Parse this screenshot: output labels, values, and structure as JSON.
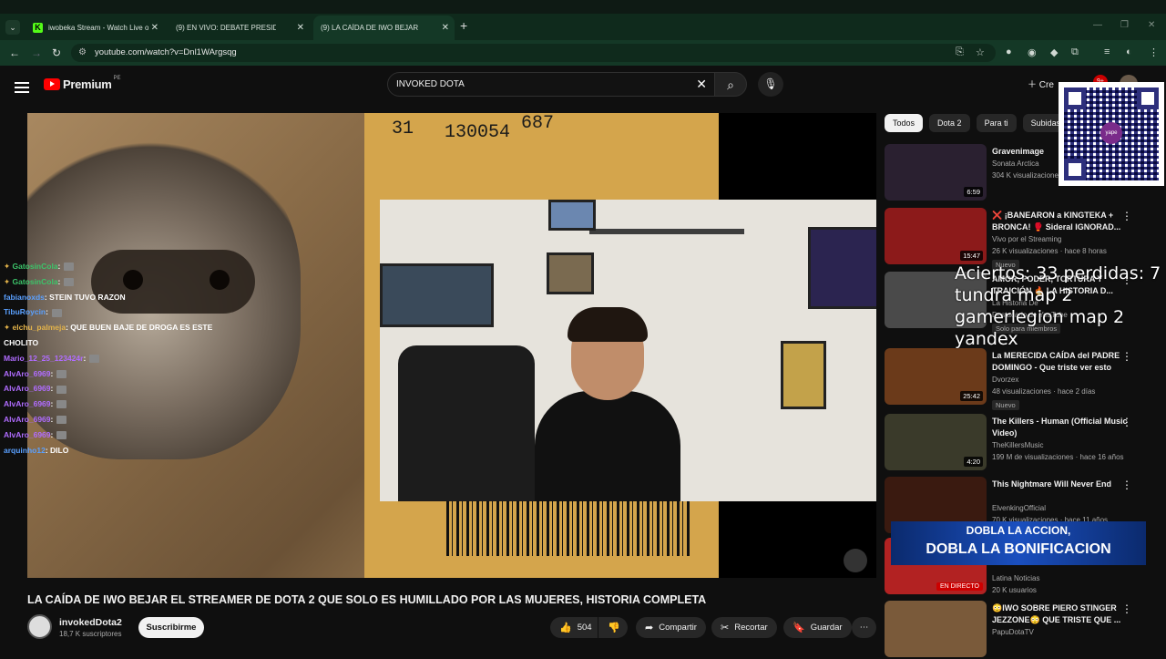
{
  "browser": {
    "tabs": [
      {
        "title": "iwobeka Stream - Watch Live o",
        "favicon": "kick-icon"
      },
      {
        "title": "(9) EN VIVO: DEBATE PRESIDEN",
        "favicon": "youtube-icon"
      },
      {
        "title": "(9) LA CAÍDA DE IWO BEJAR EL",
        "favicon": "youtube-icon",
        "active": true
      }
    ],
    "url": "youtube.com/watch?v=Dnl1WArgsqg"
  },
  "header": {
    "logo_text": "Premium",
    "country_code": "PE",
    "search_value": "INVOKED DOTA",
    "create_label": "Cre",
    "notifications": "9+"
  },
  "chat": [
    {
      "user": "GatosinCola",
      "color": "#3cc46a",
      "msg": ":",
      "emote": true,
      "badge": true
    },
    {
      "user": "GatosinCola",
      "color": "#3cc46a",
      "msg": ":",
      "emote": true,
      "badge": true
    },
    {
      "user": "fabianoxds",
      "color": "#5aa0ff",
      "msg": ": STEIN TUVO RAZON",
      "emote": false
    },
    {
      "user": "TibuRoycin",
      "color": "#5aa0ff",
      "msg": ":",
      "emote": true
    },
    {
      "user": "elchu_palmeja",
      "color": "#e3b34a",
      "msg": ": QUE BUEN BAJE DE DROGA ES ESTE",
      "emote": false,
      "badge": true
    },
    {
      "user": "",
      "color": "#fff",
      "msg": "CHOLITO",
      "emote": false
    },
    {
      "user": "Mario_12_25_123424r",
      "color": "#b06cff",
      "msg": ":",
      "emote": true
    },
    {
      "user": "AlvAro_6969",
      "color": "#b06cff",
      "msg": ":",
      "emote": true
    },
    {
      "user": "AlvAro_6969",
      "color": "#b06cff",
      "msg": ":",
      "emote": true
    },
    {
      "user": "AlvAro_6969",
      "color": "#b06cff",
      "msg": ":",
      "emote": true
    },
    {
      "user": "AlvAro_6969",
      "color": "#b06cff",
      "msg": ":",
      "emote": true
    },
    {
      "user": "AlvAro_6969",
      "color": "#b06cff",
      "msg": ":",
      "emote": true
    },
    {
      "user": "arquinho12",
      "color": "#5aa0ff",
      "msg": ": DILO",
      "emote": false
    }
  ],
  "box_text": {
    "left": "31",
    "mid": "130054",
    "right": "687"
  },
  "video": {
    "title": "LA CAÍDA DE IWO BEJAR EL STREAMER DE DOTA 2 QUE SOLO ES HUMILLADO POR LAS MUJERES, HISTORIA COMPLETA",
    "channel": "invokedDota2",
    "subscribers": "18,7 K suscriptores",
    "subscribe_label": "Suscribirme",
    "likes": "504",
    "share_label": "Compartir",
    "clip_label": "Recortar",
    "save_label": "Guardar"
  },
  "chips": [
    "Todos",
    "Dota 2",
    "Para ti",
    "Subidas r"
  ],
  "recommendations": [
    {
      "title": "Gravenimage",
      "channel": "Sonata Arctica",
      "views": "304 K visualizaciones",
      "duration": "6:59",
      "thumb": "#2a2030"
    },
    {
      "title": "❌ ¡BANEARON a KINGTEKA + BRONCA! 🥊 Sideral IGNORAD...",
      "channel": "Vivo por el Streaming",
      "views": "26 K visualizaciones · hace 8 horas",
      "duration": "15:47",
      "badge": "Nuevo",
      "thumb": "#8c1a1a"
    },
    {
      "title": "AMOR, PODER, TORTURA Y TRAICIÓN 🔥 LA HISTORIA D...",
      "channel": "La Historia De",
      "views": "Destacado de YouTube",
      "extra": "Solo para miembros",
      "thumb": "#4a4a4a"
    },
    {
      "title": "La MERECIDA CAÍDA del PADRE DOMINGO - Que triste ver esto",
      "channel": "Dvorzex",
      "views": "48 visualizaciones · hace 2 días",
      "duration": "25:42",
      "badge": "Nuevo",
      "thumb": "#6b3a1a"
    },
    {
      "title": "The Killers - Human (Official Music Video)",
      "channel": "TheKillersMusic",
      "views": "199 M de visualizaciones · hace 16 años",
      "duration": "4:20",
      "thumb": "#3a3a2a"
    },
    {
      "title": "This Nightmare Will Never End",
      "channel": "ElvenkingOfficial",
      "views": "70 K visualizaciones · hace 11 años",
      "thumb": "#3a1a10"
    },
    {
      "title": "",
      "channel": "Latina Noticias",
      "views": "20 K usuarios",
      "live": "EN DIRECTO",
      "thumb": "#b22222"
    },
    {
      "title": "😳IWO SOBRE PIERO STINGER JEZZONE😳 QUE TRISTE QUE ...",
      "channel": "PapuDotaTV",
      "views": "",
      "thumb": "#7a5a3a"
    }
  ],
  "overlay": {
    "lines": [
      "Aciertos: 33 perdidas: 7",
      "tundra map 2",
      "gamerlegion map 2",
      "yandex"
    ],
    "banner_line1": "DOBLA LA ACCION,",
    "banner_line2": "DOBLA LA BONIFICACION",
    "qr_label": "yape"
  }
}
